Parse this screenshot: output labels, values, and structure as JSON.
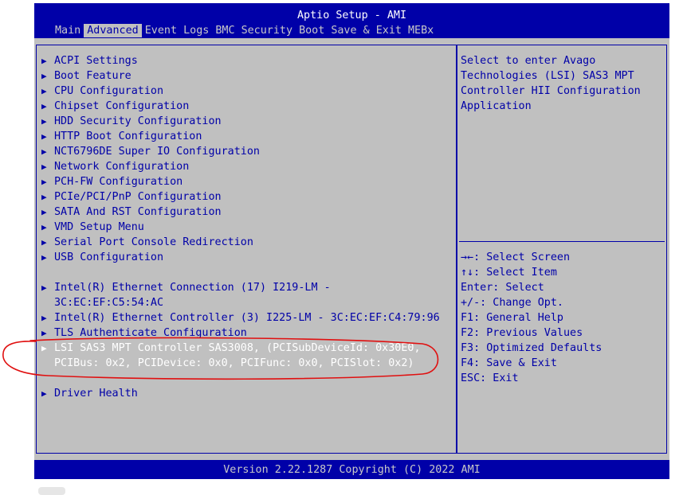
{
  "window": {
    "title": "Aptio Setup - AMI"
  },
  "tabs": [
    {
      "label": "Main",
      "active": false
    },
    {
      "label": "Advanced",
      "active": true
    },
    {
      "label": "Event Logs",
      "active": false
    },
    {
      "label": "BMC",
      "active": false
    },
    {
      "label": "Security",
      "active": false
    },
    {
      "label": "Boot",
      "active": false
    },
    {
      "label": "Save & Exit",
      "active": false
    },
    {
      "label": "MEBx",
      "active": false
    }
  ],
  "menu": {
    "items": [
      {
        "label": "ACPI Settings"
      },
      {
        "label": "Boot Feature"
      },
      {
        "label": "CPU Configuration"
      },
      {
        "label": "Chipset Configuration"
      },
      {
        "label": "HDD Security Configuration"
      },
      {
        "label": "HTTP Boot Configuration"
      },
      {
        "label": "NCT6796DE Super IO Configuration"
      },
      {
        "label": "Network Configuration"
      },
      {
        "label": "PCH-FW Configuration"
      },
      {
        "label": "PCIe/PCI/PnP Configuration"
      },
      {
        "label": "SATA And RST Configuration"
      },
      {
        "label": "VMD Setup Menu"
      },
      {
        "label": "Serial Port Console Redirection"
      },
      {
        "label": "USB Configuration"
      },
      {
        "label": "Intel(R) Ethernet Connection (17) I219-LM -",
        "cont": "3C:EC:EF:C5:54:AC"
      },
      {
        "label": "Intel(R) Ethernet Controller (3) I225-LM - 3C:EC:EF:C4:79:96"
      },
      {
        "label": "TLS Authenticate Configuration"
      },
      {
        "label": "LSI SAS3 MPT Controller SAS3008, (PCISubDeviceId: 0x30E0,",
        "cont": "PCIBus: 0x2, PCIDevice: 0x0, PCIFunc: 0x0, PCISlot: 0x2)",
        "selected": true
      },
      {
        "label": "Driver Health"
      }
    ]
  },
  "help": {
    "lines": [
      "Select to enter Avago",
      "Technologies (LSI) SAS3 MPT",
      "Controller HII Configuration",
      "Application"
    ]
  },
  "keys": {
    "lines": [
      "→←: Select Screen",
      "↑↓: Select Item",
      "Enter: Select",
      "+/-: Change Opt.",
      "F1: General Help",
      "F2: Previous Values",
      "F3: Optimized Defaults",
      "F4: Save & Exit",
      "ESC: Exit"
    ]
  },
  "footer": {
    "version": "Version 2.22.1287 Copyright (C) 2022 AMI"
  },
  "colors": {
    "bios_blue": "#0000a8",
    "bios_gray": "#c0c0c0",
    "annotation_red": "#e01010"
  }
}
